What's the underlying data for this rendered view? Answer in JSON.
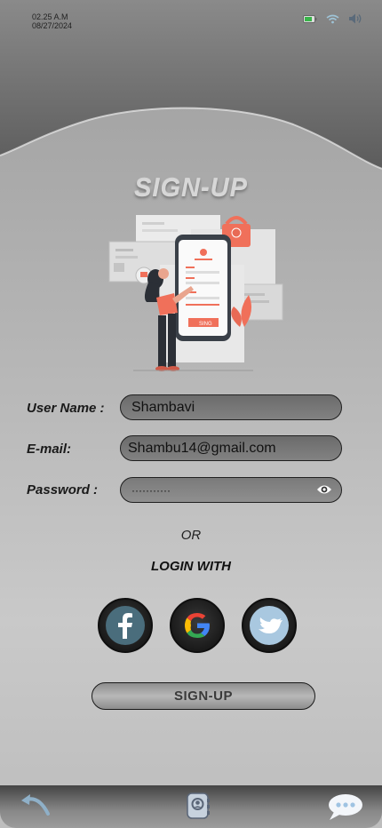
{
  "status": {
    "time": "02.25 A.M",
    "date": "08/27/2024"
  },
  "page": {
    "title": "SIGN-UP"
  },
  "form": {
    "username_label": "User Name :",
    "username_value": "Shambavi",
    "email_label": "E-mail:",
    "email_value": "Shambu14@gmail.com",
    "password_label": "Password :",
    "password_value": "···········"
  },
  "divider": {
    "or": "OR",
    "login_with": "LOGIN WITH"
  },
  "illustration": {
    "phone_button": "SING"
  },
  "social": [
    "facebook-icon",
    "google-icon",
    "twitter-icon"
  ],
  "buttons": {
    "signup": "SIGN-UP"
  },
  "colors": {
    "accent": "#f0705a",
    "background": "#bdbdbd"
  }
}
